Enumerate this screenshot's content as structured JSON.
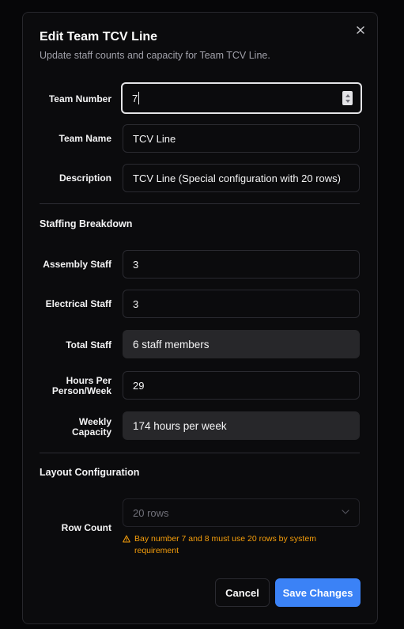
{
  "dialog": {
    "title": "Edit Team TCV Line",
    "subtitle": "Update staff counts and capacity for Team TCV Line."
  },
  "fields": {
    "team_number": {
      "label": "Team Number",
      "value": "7"
    },
    "team_name": {
      "label": "Team Name",
      "value": "TCV Line"
    },
    "description": {
      "label": "Description",
      "value": "TCV Line (Special configuration with 20 rows)"
    }
  },
  "staffing": {
    "heading": "Staffing Breakdown",
    "assembly": {
      "label": "Assembly Staff",
      "value": "3"
    },
    "electrical": {
      "label": "Electrical Staff",
      "value": "3"
    },
    "total": {
      "label": "Total Staff",
      "value": "6 staff members"
    },
    "hours": {
      "label_line1": "Hours Per",
      "label_line2": "Person/Week",
      "value": "29"
    },
    "capacity": {
      "label_line1": "Weekly",
      "label_line2": "Capacity",
      "value": "174 hours per week"
    }
  },
  "layout": {
    "heading": "Layout Configuration",
    "row_count": {
      "label": "Row Count",
      "value": "20 rows"
    },
    "warning": "Bay number 7 and 8 must use 20 rows by system requirement"
  },
  "buttons": {
    "cancel": "Cancel",
    "save": "Save Changes"
  },
  "colors": {
    "accent": "#3b82f6",
    "warning": "#f59e0b",
    "surface": "#0b0b0d"
  }
}
